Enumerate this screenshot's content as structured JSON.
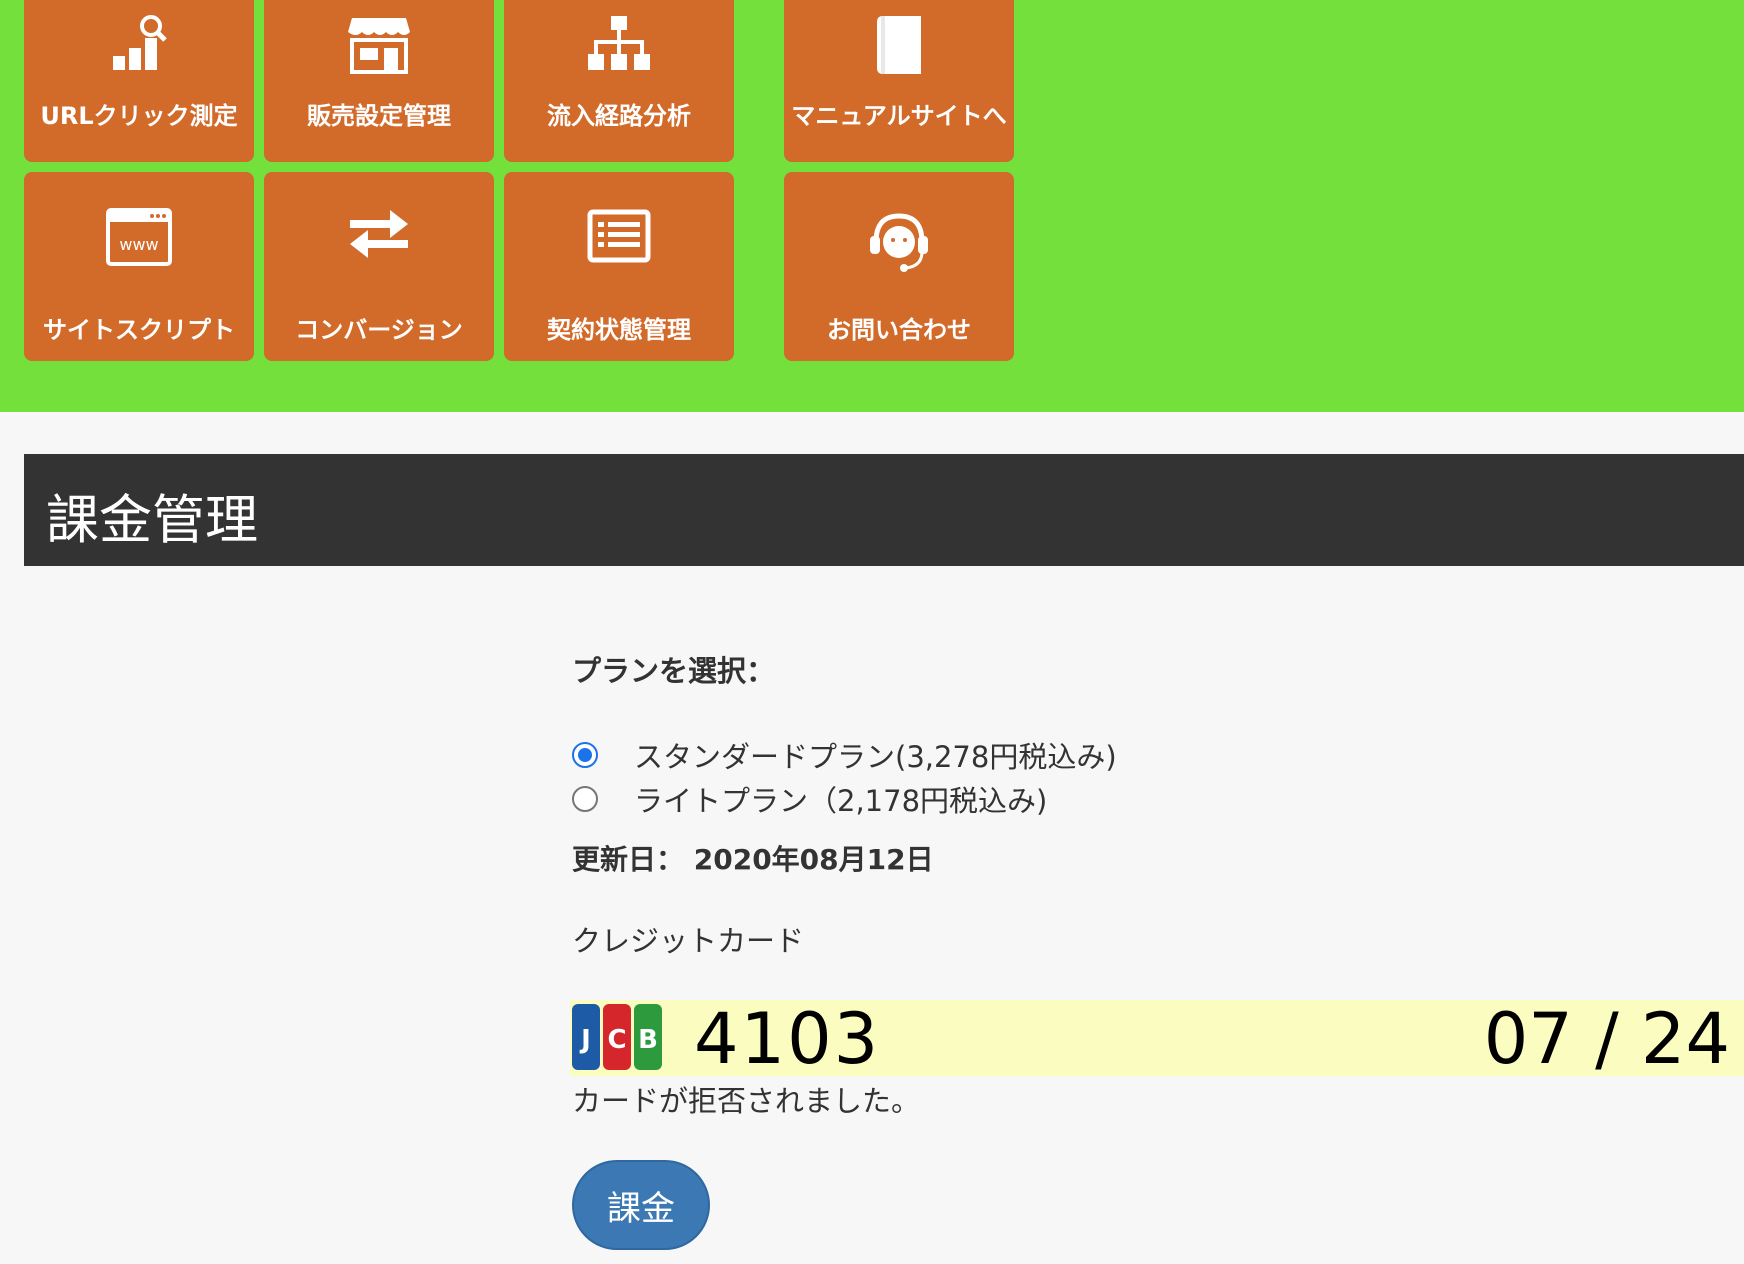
{
  "nav": {
    "row1": [
      {
        "label": "URLクリック測定",
        "icon": "chart-search-icon"
      },
      {
        "label": "販売設定管理",
        "icon": "store-icon"
      },
      {
        "label": "流入経路分析",
        "icon": "sitemap-icon"
      },
      {
        "label": "マニュアルサイトへ",
        "icon": "book-icon"
      }
    ],
    "row2": [
      {
        "label": "サイトスクリプト",
        "icon": "browser-www-icon"
      },
      {
        "label": "コンバージョン",
        "icon": "exchange-arrows-icon"
      },
      {
        "label": "契約状態管理",
        "icon": "list-icon"
      },
      {
        "label": "お問い合わせ",
        "icon": "headset-icon"
      }
    ]
  },
  "page": {
    "title": "課金管理"
  },
  "billing": {
    "plan_heading": "プランを選択：",
    "plans": [
      {
        "label": "スタンダードプラン(3,278円税込み)",
        "selected": true
      },
      {
        "label": "ライトプラン（2,178円税込み)",
        "selected": false
      }
    ],
    "updated": "更新日： 2020年08月12日",
    "card_label": "クレジットカード",
    "card": {
      "brand": "JCB",
      "last4": "4103",
      "expiry": "07 / 24"
    },
    "card_error": "カードが拒否されました。",
    "charge_button": "課金"
  },
  "colors": {
    "nav_bg": "#74e03b",
    "tile": "#d26a2a",
    "header": "#333333",
    "card_row": "#fafcc0",
    "button": "#3c79b4"
  }
}
